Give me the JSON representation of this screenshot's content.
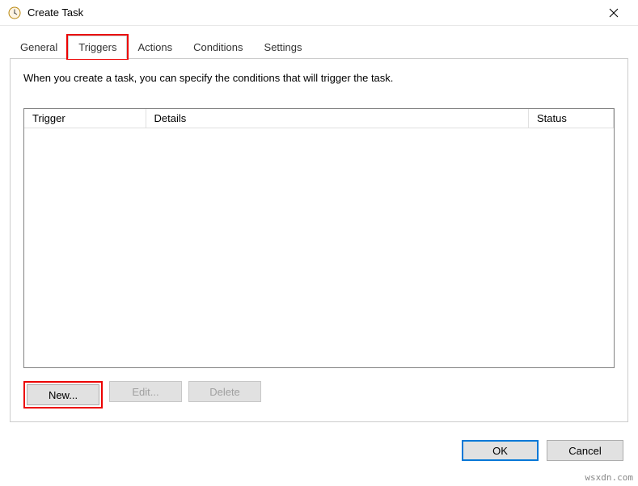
{
  "window": {
    "title": "Create Task"
  },
  "tabs": {
    "general": "General",
    "triggers": "Triggers",
    "actions": "Actions",
    "conditions": "Conditions",
    "settings": "Settings",
    "active": "triggers"
  },
  "panel": {
    "description": "When you create a task, you can specify the conditions that will trigger the task."
  },
  "table": {
    "columns": {
      "trigger": "Trigger",
      "details": "Details",
      "status": "Status"
    },
    "rows": []
  },
  "buttons": {
    "new": "New...",
    "edit": "Edit...",
    "delete": "Delete",
    "ok": "OK",
    "cancel": "Cancel"
  },
  "watermark": "wsxdn.com"
}
